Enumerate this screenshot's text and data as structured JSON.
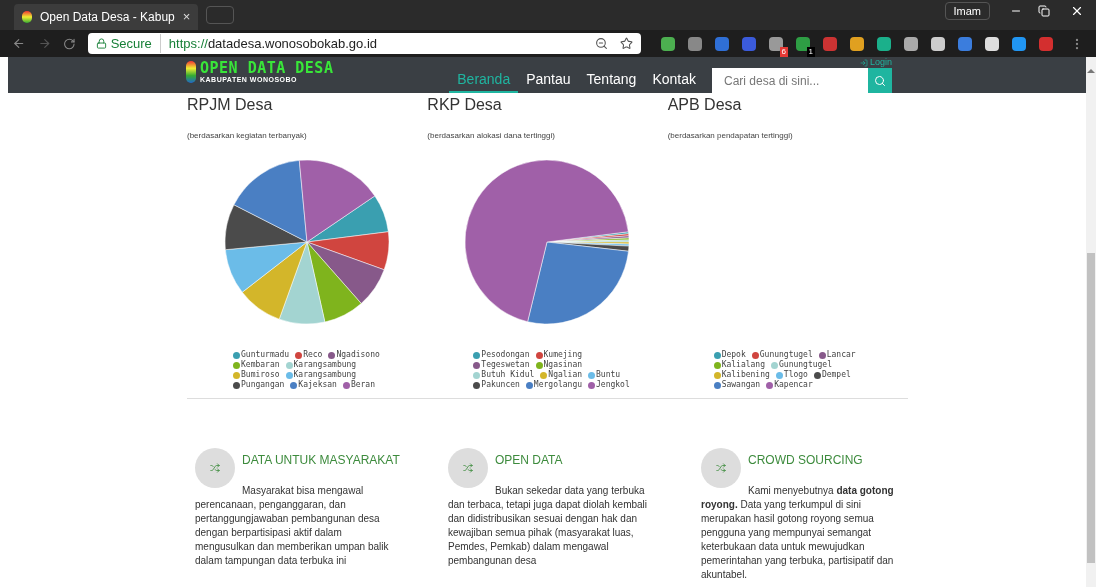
{
  "browser": {
    "tab_title": "Open Data Desa - Kabup",
    "tab_close": "×",
    "user": "Imam",
    "secure_label": "Secure",
    "url_scheme": "https://",
    "url_host": "datadesa.wonosobokab.go.id",
    "extension_badges": [
      "6",
      "1"
    ]
  },
  "site": {
    "logo_title": "OPEN DATA DESA",
    "logo_subtitle": "KABUPATEN WONOSOBO",
    "login": "Login",
    "nav": [
      {
        "label": "Beranda",
        "selected": true
      },
      {
        "label": "Pantau",
        "selected": false
      },
      {
        "label": "Tentang",
        "selected": false
      },
      {
        "label": "Kontak",
        "selected": false
      }
    ],
    "search": {
      "placeholder": "Cari desa di sini..."
    }
  },
  "panels": [
    {
      "title": "RPJM Desa",
      "subtitle": "(berdasarkan kegiatan terbanyak)",
      "pie": true,
      "legend": [
        [
          {
            "label": "Gunturmadu",
            "color": "#3a9fb0"
          },
          {
            "label": "Reco",
            "color": "#d0453f"
          },
          {
            "label": "Ngadisono",
            "color": "#87598a"
          }
        ],
        [
          {
            "label": "Kembaran",
            "color": "#7fb41d"
          },
          {
            "label": "Karangsambung",
            "color": "#a3d4d1"
          }
        ],
        [
          {
            "label": "Bumiroso",
            "color": "#d3b62a"
          },
          {
            "label": "Karangsambung",
            "color": "#6bbce8"
          }
        ],
        [
          {
            "label": "Pungangan",
            "color": "#4b4b4b"
          },
          {
            "label": "Kajeksan",
            "color": "#4a7fc3"
          },
          {
            "label": "Beran",
            "color": "#a060a8"
          }
        ]
      ]
    },
    {
      "title": "RKP Desa",
      "subtitle": "(berdasarkan alokasi dana tertinggi)",
      "pie": true,
      "legend": [
        [
          {
            "label": "Pesodongan",
            "color": "#3a9fb0"
          },
          {
            "label": "Kumejing",
            "color": "#d0453f"
          }
        ],
        [
          {
            "label": "Tegeswetan",
            "color": "#87598a"
          },
          {
            "label": "Ngasinan",
            "color": "#7fb41d"
          }
        ],
        [
          {
            "label": "Butuh Kidul",
            "color": "#a3d4d1"
          },
          {
            "label": "Ngalian",
            "color": "#d3b62a"
          },
          {
            "label": "Buntu",
            "color": "#6bbce8"
          }
        ],
        [
          {
            "label": "Pakuncen",
            "color": "#4b4b4b"
          },
          {
            "label": "Mergolangu",
            "color": "#4a7fc3"
          },
          {
            "label": "Jengkol",
            "color": "#a060a8"
          }
        ]
      ]
    },
    {
      "title": "APB Desa",
      "subtitle": "(berdasarkan pendapatan tertinggi)",
      "pie": false,
      "legend": [
        [
          {
            "label": "Depok",
            "color": "#3a9fb0"
          },
          {
            "label": "Gunungtugel",
            "color": "#d0453f"
          },
          {
            "label": "Lancar",
            "color": "#87598a"
          }
        ],
        [
          {
            "label": "Kalialang",
            "color": "#7fb41d"
          },
          {
            "label": "Gunungtugel",
            "color": "#a3d4d1"
          }
        ],
        [
          {
            "label": "Kalibening",
            "color": "#d3b62a"
          },
          {
            "label": "Tlogo",
            "color": "#6bbce8"
          },
          {
            "label": "Dempel",
            "color": "#4b4b4b"
          }
        ],
        [
          {
            "label": "Sawangan",
            "color": "#4a7fc3"
          },
          {
            "label": "Kapencar",
            "color": "#a060a8"
          }
        ]
      ]
    }
  ],
  "features": [
    {
      "title": "DATA UNTUK MASYARAKAT",
      "body": "Masyarakat bisa mengawal perencanaan, penganggaran, dan pertanggungjawaban pembangunan desa dengan berpartisipasi aktif dalam mengusulkan dan memberikan umpan balik dalam tampungan data terbuka ini"
    },
    {
      "title": "OPEN DATA",
      "body": "Bukan sekedar data yang terbuka dan terbaca, tetapi juga dapat diolah kembali dan didistribusikan sesuai dengan hak dan kewajiban semua pihak (masyarakat luas, Pemdes, Pemkab) dalam mengawal pembangunan desa"
    },
    {
      "title": "CROWD SOURCING",
      "body": "Kami menyebutnya **data gotong royong.** Data yang terkumpul di sini merupakan hasil gotong royong semua pengguna yang mempunyai semangat keterbukaan data untuk mewujudkan pemerintahan yang terbuka, partisipatif dan akuntabel."
    }
  ]
}
